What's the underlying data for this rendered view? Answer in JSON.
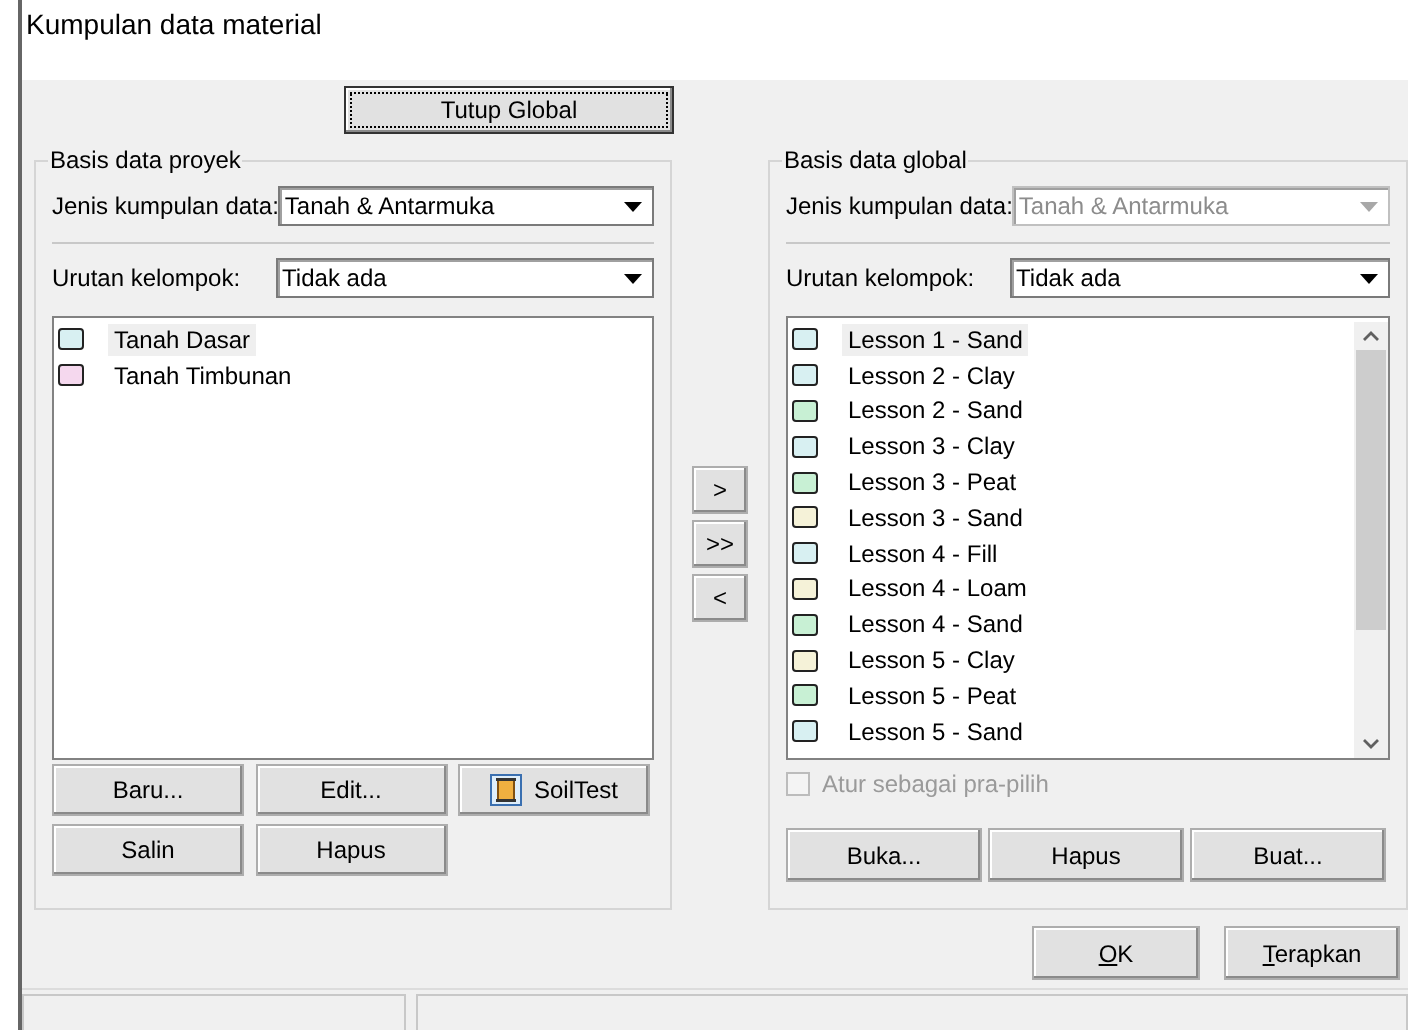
{
  "window": {
    "title": "Kumpulan data material"
  },
  "toggle_button": {
    "label": "Tutup Global"
  },
  "project_group": {
    "title": "Basis data proyek",
    "fields": [
      {
        "label": "Jenis kumpulan data:",
        "value": "Tanah & Antarmuka",
        "disabled": false
      },
      {
        "label": "Urutan kelompok:",
        "value": "Tidak ada",
        "disabled": false
      }
    ],
    "items": [
      {
        "label": "Tanah Dasar",
        "color": "#d8f0f2",
        "selected": true
      },
      {
        "label": "Tanah Timbunan",
        "color": "#f5d8ee",
        "selected": false
      }
    ],
    "buttons": [
      {
        "label": "Baru...",
        "kind": "text"
      },
      {
        "label": "Edit...",
        "kind": "text"
      },
      {
        "label": "SoilTest",
        "kind": "icon"
      },
      {
        "label": "Salin",
        "kind": "text"
      },
      {
        "label": "Hapus",
        "kind": "text"
      }
    ]
  },
  "transfer_buttons": [
    ">",
    ">>",
    "<"
  ],
  "global_group": {
    "title": "Basis data global",
    "fields": [
      {
        "label": "Jenis kumpulan data:",
        "value": "Tanah & Antarmuka",
        "disabled": true
      },
      {
        "label": "Urutan kelompok:",
        "value": "Tidak ada",
        "disabled": false
      }
    ],
    "items": [
      {
        "label": "Lesson 1 - Sand",
        "color": "#d8f0f2",
        "selected": true
      },
      {
        "label": "Lesson 2 - Clay",
        "color": "#d8f0f2",
        "selected": false
      },
      {
        "label": "Lesson 2 - Sand",
        "color": "#c8f0d4",
        "selected": false
      },
      {
        "label": "Lesson 3 - Clay",
        "color": "#d8f0f2",
        "selected": false
      },
      {
        "label": "Lesson 3 - Peat",
        "color": "#c8f0d4",
        "selected": false
      },
      {
        "label": "Lesson 3 - Sand",
        "color": "#f5f2d8",
        "selected": false
      },
      {
        "label": "Lesson 4 - Fill",
        "color": "#d8f0f2",
        "selected": false
      },
      {
        "label": "Lesson 4 - Loam",
        "color": "#f5f2d8",
        "selected": false
      },
      {
        "label": "Lesson 4 - Sand",
        "color": "#c8f0d4",
        "selected": false
      },
      {
        "label": "Lesson 5 - Clay",
        "color": "#f5f2d8",
        "selected": false
      },
      {
        "label": "Lesson 5 - Peat",
        "color": "#c8f0d4",
        "selected": false
      },
      {
        "label": "Lesson 5 - Sand",
        "color": "#d8f0f2",
        "selected": false
      }
    ],
    "preselect": {
      "label": "Atur sebagai pra-pilih",
      "checked": false,
      "disabled": true
    },
    "buttons": [
      {
        "label": "Buka..."
      },
      {
        "label": "Hapus"
      },
      {
        "label": "Buat..."
      }
    ]
  },
  "dialog_buttons": [
    {
      "label": "OK"
    },
    {
      "label": "Terapkan"
    }
  ]
}
